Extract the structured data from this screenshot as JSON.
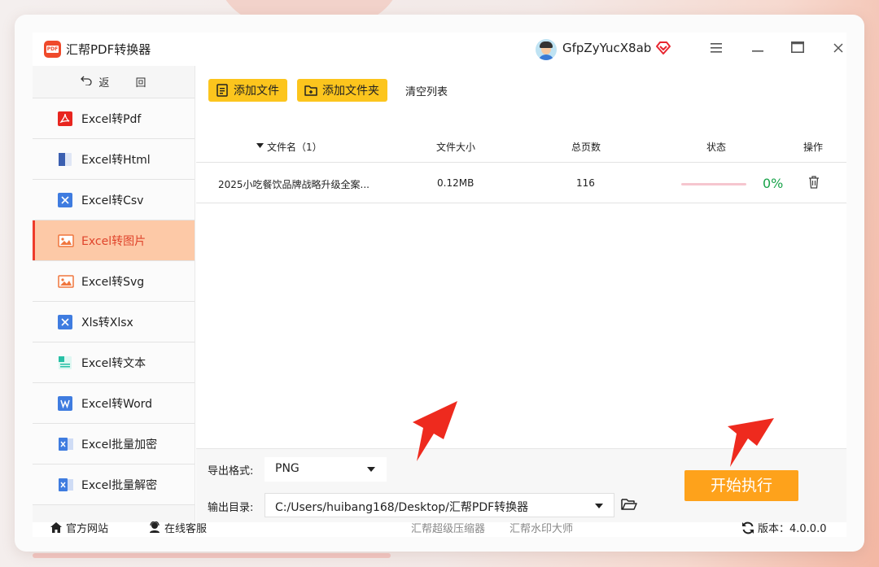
{
  "app": {
    "title": "汇帮PDF转换器",
    "logo_text": "PDF"
  },
  "user": {
    "name": "GfpZyYucX8ab"
  },
  "sidebar": {
    "back_label": "返 回",
    "items": [
      {
        "label": "Excel转Pdf",
        "icon": "pdf-icon"
      },
      {
        "label": "Excel转Html",
        "icon": "html-icon"
      },
      {
        "label": "Excel转Csv",
        "icon": "excel-icon"
      },
      {
        "label": "Excel转图片",
        "icon": "image-icon",
        "active": true
      },
      {
        "label": "Excel转Svg",
        "icon": "image-icon"
      },
      {
        "label": "Xls转Xlsx",
        "icon": "excel-icon"
      },
      {
        "label": "Excel转文本",
        "icon": "text-icon"
      },
      {
        "label": "Excel转Word",
        "icon": "word-icon"
      },
      {
        "label": "Excel批量加密",
        "icon": "excel-icon"
      },
      {
        "label": "Excel批量解密",
        "icon": "excel-icon"
      }
    ]
  },
  "toolbar": {
    "add_file": "添加文件",
    "add_folder": "添加文件夹",
    "clear": "清空列表"
  },
  "table": {
    "headers": {
      "name": "文件名（1）",
      "size": "文件大小",
      "pages": "总页数",
      "status": "状态",
      "action": "操作"
    },
    "rows": [
      {
        "name": "2025小吃餐饮品牌战略升级全案...",
        "size": "0.12MB",
        "pages": "116",
        "progress_pct": 0,
        "progress_text": "0%"
      }
    ]
  },
  "settings": {
    "format_label": "导出格式:",
    "format_value": "PNG",
    "dir_label": "输出目录:",
    "dir_value": "C:/Users/huibang168/Desktop/汇帮PDF转换器",
    "start_label": "开始执行"
  },
  "statusbar": {
    "website": "官方网站",
    "service": "在线客服",
    "link1": "汇帮超级压缩器",
    "link2": "汇帮水印大师",
    "version": "版本：4.0.0.0"
  },
  "colors": {
    "accent": "#fea21b",
    "toolbar_button": "#fcc51d",
    "active_item": "#fdc9a7",
    "active_text": "#e0442b",
    "success": "#19a34a",
    "annotation_arrow": "#ee2a1e"
  }
}
